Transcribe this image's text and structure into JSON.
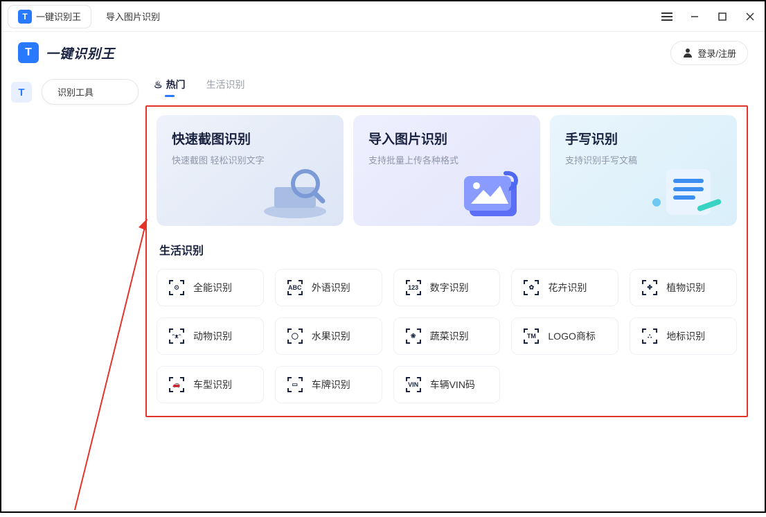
{
  "titlebar": {
    "tabs": [
      {
        "label": "一键识别王",
        "active": true
      },
      {
        "label": "导入图片识别",
        "active": false
      }
    ]
  },
  "header": {
    "brand": "一键识别王",
    "login": "登录/注册"
  },
  "sidebar": {
    "tool_label": "识别工具"
  },
  "main": {
    "tabs": [
      {
        "label": "热门",
        "active": true
      },
      {
        "label": "生活识别",
        "active": false
      }
    ],
    "heroes": [
      {
        "title": "快速截图识别",
        "sub": "快速截图 轻松识别文字"
      },
      {
        "title": "导入图片识别",
        "sub": "支持批量上传各种格式"
      },
      {
        "title": "手写识别",
        "sub": "支持识别手写文稿"
      }
    ],
    "section_title": "生活识别",
    "items": [
      {
        "label": "全能识别",
        "glyph": "⊙"
      },
      {
        "label": "外语识别",
        "glyph": "ABC"
      },
      {
        "label": "数字识别",
        "glyph": "123"
      },
      {
        "label": "花卉识别",
        "glyph": "✿"
      },
      {
        "label": "植物识别",
        "glyph": "✤"
      },
      {
        "label": "动物识别",
        "glyph": "ᵔᴥᵔ"
      },
      {
        "label": "水果识别",
        "glyph": "◯"
      },
      {
        "label": "蔬菜识别",
        "glyph": "❀"
      },
      {
        "label": "LOGO商标",
        "glyph": "TM"
      },
      {
        "label": "地标识别",
        "glyph": "⛬"
      },
      {
        "label": "车型识别",
        "glyph": "🚗"
      },
      {
        "label": "车牌识别",
        "glyph": "▭"
      },
      {
        "label": "车辆VIN码",
        "glyph": "VIN"
      }
    ]
  }
}
